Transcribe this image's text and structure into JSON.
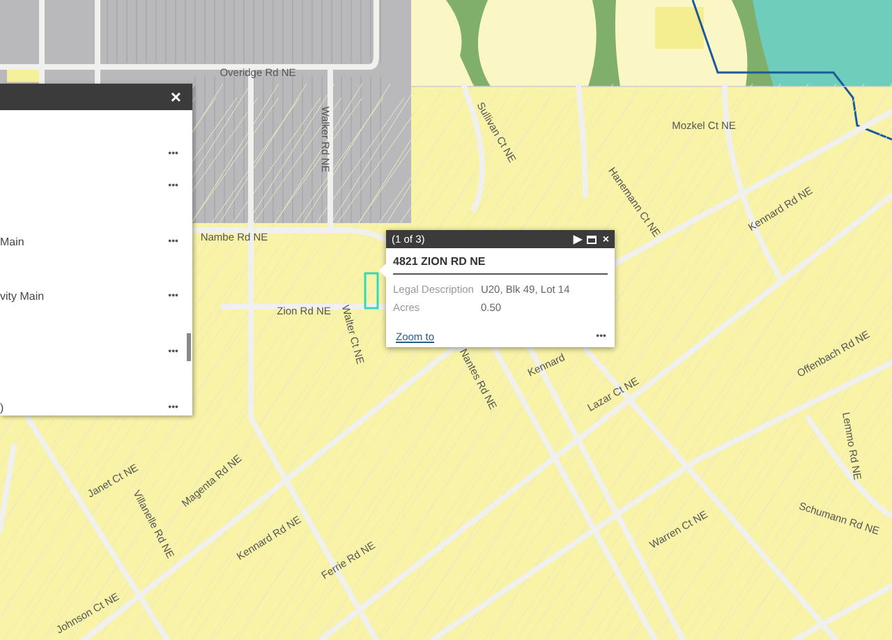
{
  "map": {
    "labels": [
      {
        "text": "Overidge Rd NE"
      },
      {
        "text": "Walker Rd NE"
      },
      {
        "text": "Sullivan Ct NE"
      },
      {
        "text": "Mozkel Ct NE"
      },
      {
        "text": "Hanemann Ct NE"
      },
      {
        "text": "Kennard Rd NE"
      },
      {
        "text": "Nambe Rd NE"
      },
      {
        "text": "Zion Rd NE"
      },
      {
        "text": "Walter Ct NE"
      },
      {
        "text": "Nantes Rd NE"
      },
      {
        "text": "Kennard"
      },
      {
        "text": "Lazar Ct NE"
      },
      {
        "text": "Offenbach Rd NE"
      },
      {
        "text": "Janet Ct NE"
      },
      {
        "text": "Villanelle Rd NE"
      },
      {
        "text": "Magenta Rd NE"
      },
      {
        "text": "Kennard Rd NE"
      },
      {
        "text": "Ferrie Rd NE"
      },
      {
        "text": "Warren Ct NE"
      },
      {
        "text": "Lemmo Rd NE"
      },
      {
        "text": "Schumann Rd NE"
      },
      {
        "text": "Johnson Ct NE"
      }
    ]
  },
  "panel": {
    "close": "×",
    "rows": [
      {
        "more": "•••"
      },
      {
        "more": "•••"
      },
      {
        "text": "Main",
        "more": "•••"
      },
      {
        "text": "vity Main",
        "more": "•••"
      },
      {
        "more": "•••"
      },
      {
        "text": ")",
        "more": "•••"
      }
    ]
  },
  "popup": {
    "counter": "(1 of 3)",
    "next": "▶",
    "close": "×",
    "title": "4821 ZION RD NE",
    "fields": [
      {
        "label": "Legal Description",
        "value": "U20, Blk 49, Lot 14"
      },
      {
        "label": "Acres",
        "value": "0.50"
      }
    ],
    "link": "Zoom to",
    "more": "•••"
  }
}
